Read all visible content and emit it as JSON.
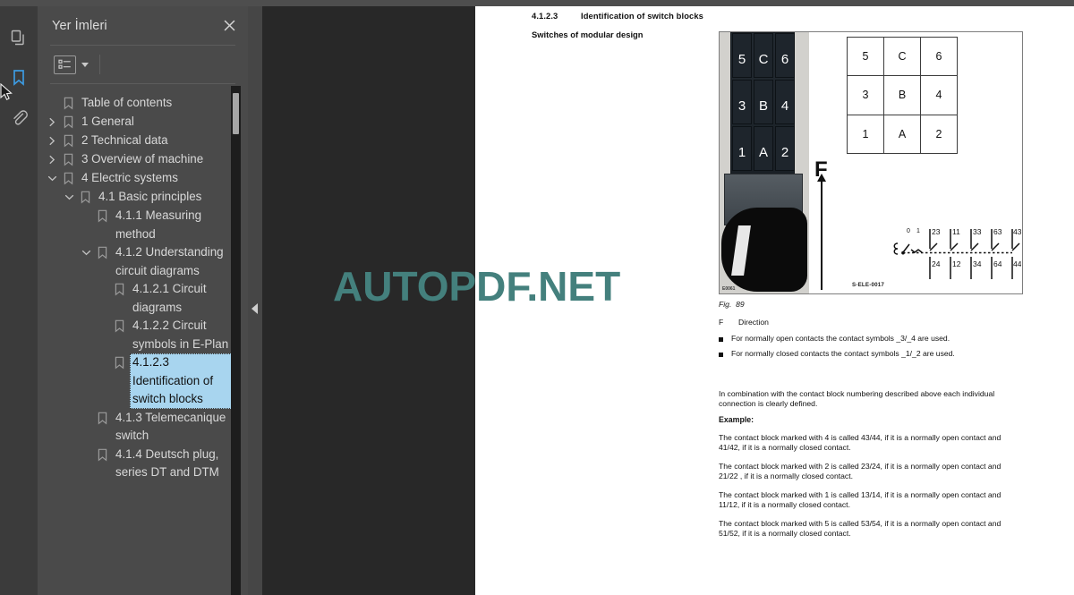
{
  "window": {
    "watermark": "AUTOPDF.NET"
  },
  "rail": {
    "items": [
      {
        "name": "thumbnails-icon",
        "label": "Sayfa Küçük Resimleri",
        "active": false
      },
      {
        "name": "bookmark-icon",
        "label": "Yer İmleri",
        "active": true
      },
      {
        "name": "attachment-icon",
        "label": "Ekler",
        "active": false
      }
    ]
  },
  "bookmarks_panel": {
    "title": "Yer İmleri",
    "close_label": "✕",
    "toolbar": {
      "list_options_label": "Seçenekler",
      "caret_label": "▾"
    },
    "tree": [
      {
        "label": "Table of contents",
        "depth": 0,
        "twisty": "none",
        "selected": false
      },
      {
        "label": "1 General",
        "depth": 0,
        "twisty": "collapsed",
        "selected": false
      },
      {
        "label": "2 Technical data",
        "depth": 0,
        "twisty": "collapsed",
        "selected": false
      },
      {
        "label": "3 Overview of machine",
        "depth": 0,
        "twisty": "collapsed",
        "selected": false
      },
      {
        "label": "4 Electric systems",
        "depth": 0,
        "twisty": "expanded",
        "selected": false
      },
      {
        "label": "4.1 Basic principles",
        "depth": 1,
        "twisty": "expanded",
        "selected": false
      },
      {
        "label": "4.1.1 Measuring method",
        "depth": 2,
        "twisty": "none",
        "selected": false
      },
      {
        "label": "4.1.2 Understanding circuit diagrams",
        "depth": 2,
        "twisty": "expanded",
        "selected": false
      },
      {
        "label": "4.1.2.1 Circuit diagrams",
        "depth": 3,
        "twisty": "none",
        "selected": false
      },
      {
        "label": "4.1.2.2 Circuit symbols in E-Plan",
        "depth": 3,
        "twisty": "none",
        "selected": false
      },
      {
        "label": "4.1.2.3 Identification of switch blocks",
        "depth": 3,
        "twisty": "none",
        "selected": true
      },
      {
        "label": "4.1.3 Telemecanique switch",
        "depth": 2,
        "twisty": "none",
        "selected": false
      },
      {
        "label": "4.1.4 Deutsch plug, series DT and DTM",
        "depth": 2,
        "twisty": "none",
        "selected": false
      }
    ]
  },
  "document": {
    "heading_number": "4.1.2.3",
    "heading_text": "Identification of switch blocks",
    "subheading": "Switches of modular design",
    "figure": {
      "photo_id": "E0061",
      "drawing_code": "S-ELE-0017",
      "direction_letter": "F",
      "table": [
        [
          "5",
          "C",
          "6"
        ],
        [
          "3",
          "B",
          "4"
        ],
        [
          "1",
          "A",
          "2"
        ]
      ],
      "switch_labels": [
        [
          "5",
          "C",
          "6"
        ],
        [
          "3",
          "B",
          "4"
        ],
        [
          "1",
          "A",
          "2"
        ]
      ],
      "circuit_positions": [
        "0",
        "1"
      ],
      "circuit_top_terminals": [
        "23",
        "11",
        "33",
        "63",
        "43"
      ],
      "circuit_bottom_terminals": [
        "24",
        "12",
        "34",
        "64",
        "44"
      ]
    },
    "caption": {
      "fig_label": "Fig.",
      "fig_number": "89",
      "key_letter": "F",
      "key_text": "Direction"
    },
    "bullets": [
      "For normally open contacts the contact symbols _3/_4 are used.",
      "For normally closed contacts the contact symbols _1/_2 are used."
    ],
    "paragraph_combination": "In combination with the contact block numbering described above each individual connection is clearly defined.",
    "example_label": "Example:",
    "examples": [
      "The contact block marked with 4 is called 43/44, if it is a normally open contact and 41/42, if it is a normally closed contact.",
      "The contact block marked with 2 is called 23/24, if it is a normally open contact and 21/22 , if it is a normally closed contact.",
      "The contact block marked with 1 is called 13/14, if it is a normally open contact and 11/12, if it is a normally closed contact.",
      "The contact block marked with 5 is called 53/54, if it is a normally open contact and 51/52, if it is a normally closed contact."
    ]
  },
  "colors": {
    "panel_bg": "#4a4a4a",
    "rail_bg": "#3b3b3b",
    "viewer_bg": "#282828",
    "accent_blue": "#3d9ae0",
    "selection_blue": "#a8d5ef",
    "watermark": "#44807d"
  }
}
